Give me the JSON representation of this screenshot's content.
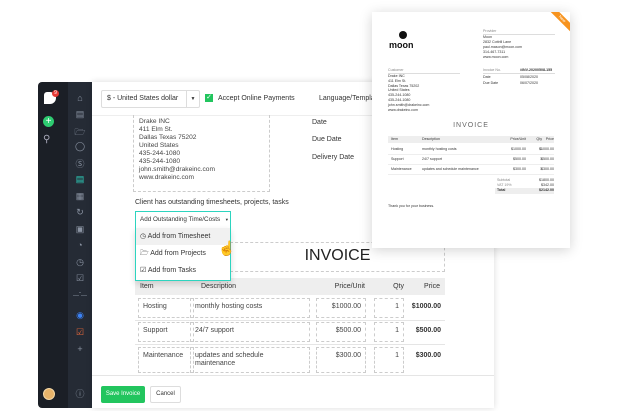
{
  "sidebar": {
    "badge": "9",
    "icons": [
      "home-icon",
      "contacts-icon",
      "folder-icon",
      "client-icon",
      "billing-icon",
      "invoice-icon",
      "dashboard-icon",
      "recurring-icon",
      "wallet-icon",
      "reports-icon",
      "time-icon",
      "calendar-icon"
    ]
  },
  "toolbar": {
    "currency": "$ - United States dollar",
    "accept_online_payments": "Accept Online Payments",
    "language": "Language/Templa"
  },
  "client": {
    "lines": [
      "Drake INC",
      "411 Elm St.",
      "Dallas Texas 75202",
      "United States",
      "435-244-1080",
      "435-244-1080",
      "john.smith@drakeinc.com",
      "www.drakeinc.com"
    ]
  },
  "dates": {
    "date": "Date",
    "due": "Due Date",
    "delivery": "Delivery Date"
  },
  "outstanding": {
    "notice": "Client has outstanding timesheets, projects, tasks",
    "button": "Add Outstanding Time/Costs",
    "menu": [
      "Add from Timesheet",
      "Add from Projects",
      "Add from Tasks"
    ]
  },
  "invoice": {
    "title": "INVOICE",
    "headers": [
      "Item",
      "Description",
      "Price/Unit",
      "Qty",
      "Price"
    ],
    "rows": [
      [
        "Hosting",
        "monthly hosting costs",
        "$1000.00",
        "1",
        "$1000.00"
      ],
      [
        "Support",
        "24/7 support",
        "$500.00",
        "1",
        "$500.00"
      ],
      [
        "Maintenance",
        "updates and schedule maintenance",
        "$300.00",
        "1",
        "$300.00"
      ]
    ]
  },
  "footer": {
    "save": "Save Invoice",
    "cancel": "Cancel"
  },
  "preview": {
    "ribbon": "New",
    "logo": "moon",
    "provider_label": "Provider",
    "provider": [
      "Moon",
      "2832 Cottrill Lane",
      "paul.mason@moon.com",
      "314-467-7311",
      "www.moon.com"
    ],
    "customer_label": "Customer",
    "customer": [
      "Drake INC",
      "411 Elm St.",
      "Dallas Texas 75202",
      "United States",
      "435-244-1080",
      "435-244-1080",
      "john.smith@drakeinc.com",
      "www.drakeinc.com"
    ],
    "invoice_no_label": "Invoice No.",
    "invoice_no": "#INV-20200508-155",
    "date_label": "Date",
    "date": "05/08/2020",
    "due_label": "Due Date",
    "due": "06/07/2020",
    "title": "INVOICE",
    "headers": [
      "Item",
      "Description",
      "Price/Unit",
      "Qty",
      "Price"
    ],
    "rows": [
      [
        "Hosting",
        "monthly hosting costs",
        "$1000.00",
        "1",
        "$1000.00"
      ],
      [
        "Support",
        "24/7 support",
        "$500.00",
        "1",
        "$500.00"
      ],
      [
        "Maintenance",
        "updates and schedule maintenance",
        "$300.00",
        "1",
        "$300.00"
      ]
    ],
    "subtotal_label": "Subtotal",
    "subtotal": "$1800.00",
    "vat_label": "VAT 19%",
    "vat": "$342.00",
    "total_label": "Total",
    "total": "$2142.00",
    "thanks": "Thank you for your business."
  }
}
